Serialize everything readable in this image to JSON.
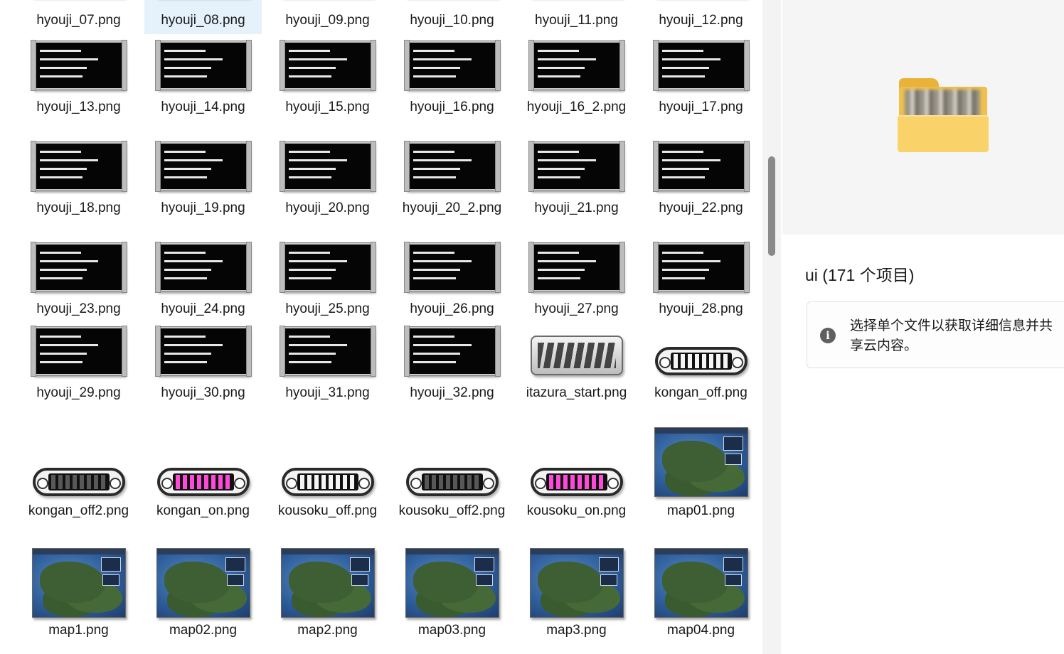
{
  "files": [
    {
      "name": "hyouji_07.png",
      "type": "card",
      "selected": false
    },
    {
      "name": "hyouji_08.png",
      "type": "card",
      "selected": true
    },
    {
      "name": "hyouji_09.png",
      "type": "card",
      "selected": false
    },
    {
      "name": "hyouji_10.png",
      "type": "card",
      "selected": false
    },
    {
      "name": "hyouji_11.png",
      "type": "card",
      "selected": false
    },
    {
      "name": "hyouji_12.png",
      "type": "card",
      "selected": false
    },
    {
      "name": "hyouji_13.png",
      "type": "card",
      "selected": false
    },
    {
      "name": "hyouji_14.png",
      "type": "card",
      "selected": false
    },
    {
      "name": "hyouji_15.png",
      "type": "card",
      "selected": false
    },
    {
      "name": "hyouji_16.png",
      "type": "card",
      "selected": false
    },
    {
      "name": "hyouji_16_2.png",
      "type": "card",
      "selected": false
    },
    {
      "name": "hyouji_17.png",
      "type": "card",
      "selected": false
    },
    {
      "name": "hyouji_18.png",
      "type": "card",
      "selected": false
    },
    {
      "name": "hyouji_19.png",
      "type": "card",
      "selected": false
    },
    {
      "name": "hyouji_20.png",
      "type": "card",
      "selected": false
    },
    {
      "name": "hyouji_20_2.png",
      "type": "card",
      "selected": false
    },
    {
      "name": "hyouji_21.png",
      "type": "card",
      "selected": false
    },
    {
      "name": "hyouji_22.png",
      "type": "card",
      "selected": false
    },
    {
      "name": "hyouji_23.png",
      "type": "card",
      "selected": false
    },
    {
      "name": "hyouji_24.png",
      "type": "card",
      "selected": false
    },
    {
      "name": "hyouji_25.png",
      "type": "card",
      "selected": false
    },
    {
      "name": "hyouji_26.png",
      "type": "card",
      "selected": false
    },
    {
      "name": "hyouji_27.png",
      "type": "card",
      "selected": false
    },
    {
      "name": "hyouji_28.png",
      "type": "card",
      "selected": false
    },
    {
      "name": "hyouji_29.png",
      "type": "card",
      "selected": false
    },
    {
      "name": "hyouji_30.png",
      "type": "card",
      "selected": false
    },
    {
      "name": "hyouji_31.png",
      "type": "card",
      "selected": false
    },
    {
      "name": "hyouji_32.png",
      "type": "card",
      "selected": false
    },
    {
      "name": "itazura_start.png",
      "type": "start",
      "selected": false
    },
    {
      "name": "kongan_off.png",
      "type": "btn-white",
      "selected": false
    },
    {
      "name": "kongan_off2.png",
      "type": "btn-grey",
      "selected": false
    },
    {
      "name": "kongan_on.png",
      "type": "btn-pink",
      "selected": false
    },
    {
      "name": "kousoku_off.png",
      "type": "btn-white",
      "selected": false
    },
    {
      "name": "kousoku_off2.png",
      "type": "btn-grey",
      "selected": false
    },
    {
      "name": "kousoku_on.png",
      "type": "btn-pink",
      "selected": false
    },
    {
      "name": "map01.png",
      "type": "map",
      "selected": false
    },
    {
      "name": "map1.png",
      "type": "map",
      "selected": false
    },
    {
      "name": "map02.png",
      "type": "map",
      "selected": false
    },
    {
      "name": "map2.png",
      "type": "map",
      "selected": false
    },
    {
      "name": "map03.png",
      "type": "map",
      "selected": false
    },
    {
      "name": "map3.png",
      "type": "map",
      "selected": false
    },
    {
      "name": "map04.png",
      "type": "map",
      "selected": false
    }
  ],
  "details": {
    "title": "ui (171 个项目)",
    "info_icon": "info-icon",
    "info_text": "选择单个文件以获取详细信息并共享云内容。",
    "preview_icon": "folder-icon"
  },
  "colors": {
    "selection": "#e5f1fb",
    "preview_bg": "#f5f5f5",
    "scroll_thumb": "#8a8a8a"
  }
}
